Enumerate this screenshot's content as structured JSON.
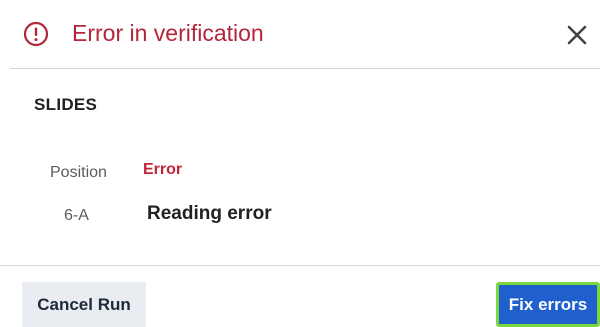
{
  "header": {
    "title": "Error in verification",
    "icon": "alert-circle-icon",
    "close_icon": "close-icon"
  },
  "section": {
    "title": "SLIDES"
  },
  "table": {
    "headers": {
      "position": "Position",
      "error": "Error"
    },
    "rows": [
      {
        "position": "6-A",
        "error": "Reading error"
      }
    ]
  },
  "footer": {
    "cancel_label": "Cancel Run",
    "fix_label": "Fix errors"
  },
  "colors": {
    "error_red": "#b3263a",
    "primary_blue": "#1f5fce",
    "focus_green": "#7bd73e",
    "secondary_bg": "#e9edf1"
  }
}
